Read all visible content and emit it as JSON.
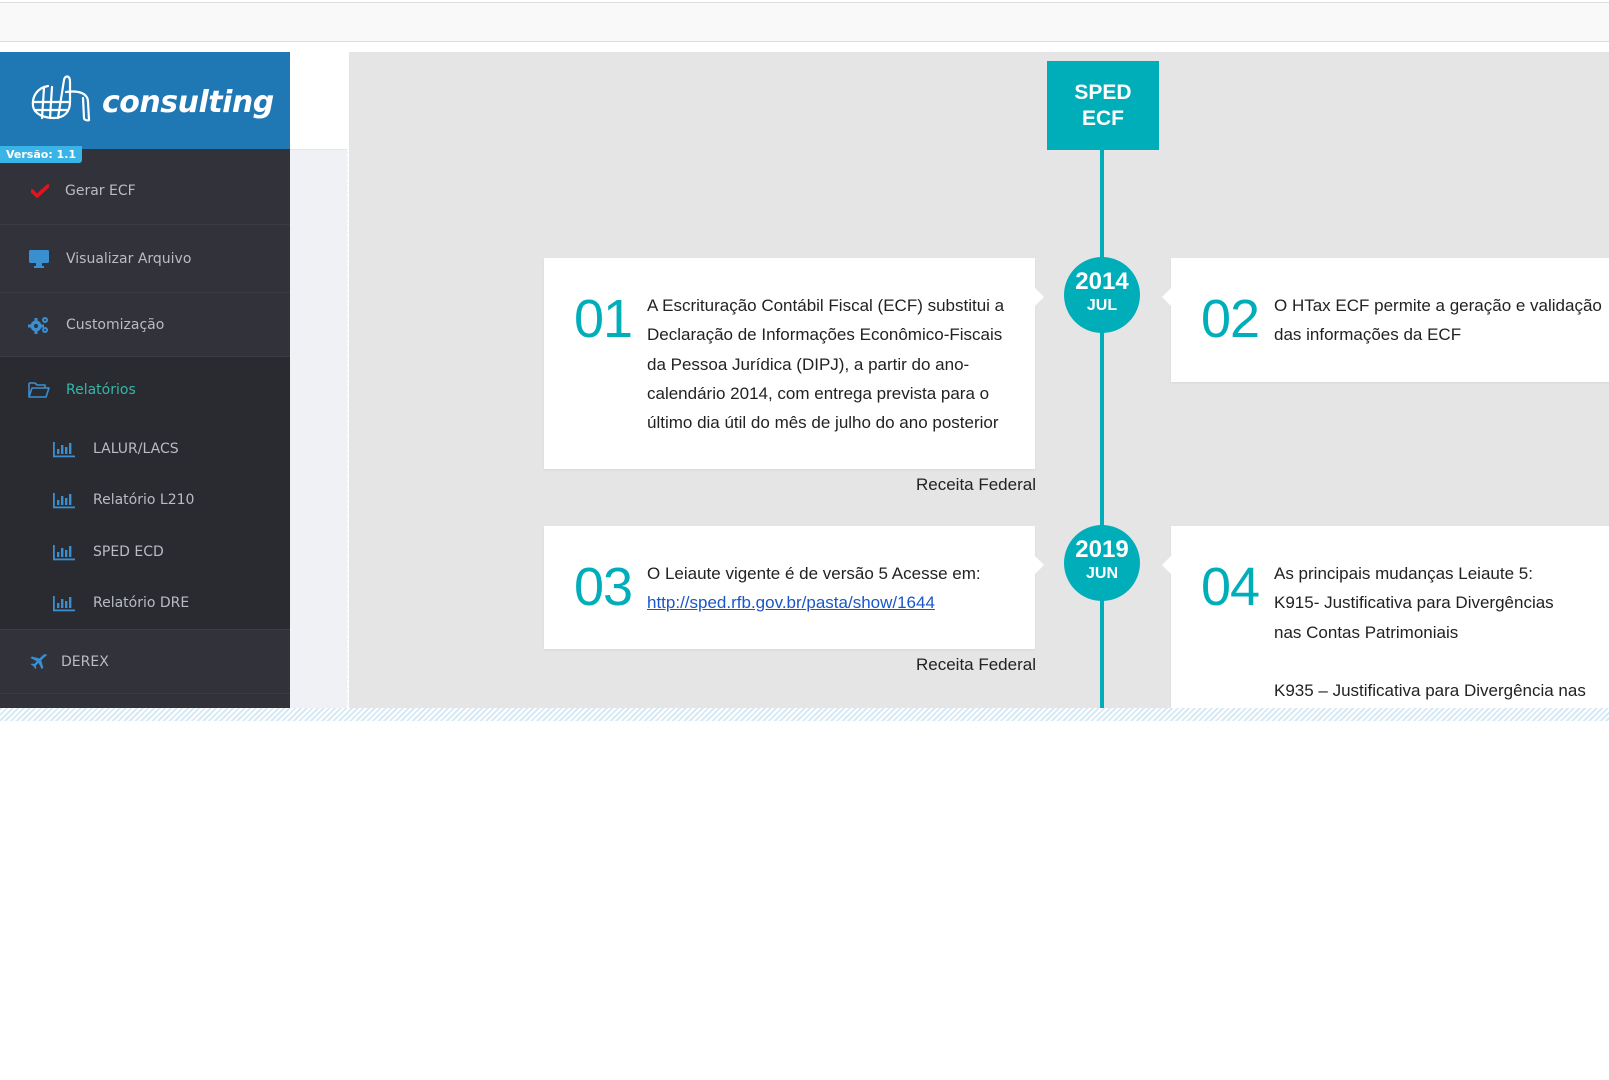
{
  "brand": {
    "logo_text": "consulting",
    "version_badge": "Versão: 1.1",
    "colors": {
      "header_blue": "#1f78b4",
      "accent_teal": "#00aeba",
      "active_menu": "#33b8a8",
      "sidebar_bg": "#32323a",
      "check_red": "#e8121b",
      "icon_blue": "#3a8fd0"
    }
  },
  "sidebar": {
    "items": [
      {
        "label": "Gerar ECF",
        "icon": "check-icon"
      },
      {
        "label": "Visualizar Arquivo",
        "icon": "monitor-icon"
      },
      {
        "label": "Customização",
        "icon": "gears-icon"
      },
      {
        "label": "Relatórios",
        "icon": "folder-open-icon",
        "active": true,
        "children": [
          {
            "label": "LALUR/LACS",
            "icon": "bar-chart-icon"
          },
          {
            "label": "Relatório L210",
            "icon": "bar-chart-icon"
          },
          {
            "label": "SPED ECD",
            "icon": "bar-chart-icon"
          },
          {
            "label": "Relatório DRE",
            "icon": "bar-chart-icon"
          }
        ]
      },
      {
        "label": "DEREX",
        "icon": "plane-icon"
      }
    ]
  },
  "timeline": {
    "header_line1": "SPED",
    "header_line2": "ECF",
    "milestones": [
      {
        "year": "2014",
        "month": "JUL"
      },
      {
        "year": "2019",
        "month": "JUN"
      }
    ],
    "cards": [
      {
        "number": "01",
        "text": "A Escrituração Contábil Fiscal (ECF) substitui a Declaração de Informações Econômico-Fiscais da Pessoa Jurídica (DIPJ), a partir do ano-calendário 2014, com entrega prevista para o último dia útil do mês de julho do ano posterior",
        "source": "Receita Federal"
      },
      {
        "number": "02",
        "text": "O HTax ECF permite a geração e validação das informações da ECF"
      },
      {
        "number": "03",
        "text": "O Leiaute vigente é de versão 5 Acesse em:",
        "link": "http://sped.rfb.gov.br/pasta/show/1644",
        "source": "Receita Federal"
      },
      {
        "number": "04",
        "line1": "As principais mudanças Leiaute 5:",
        "line2": "K915- Justificativa para Divergências nas Contas Patrimoniais",
        "line3": "K935 – Justificativa para Divergência nas"
      }
    ]
  }
}
